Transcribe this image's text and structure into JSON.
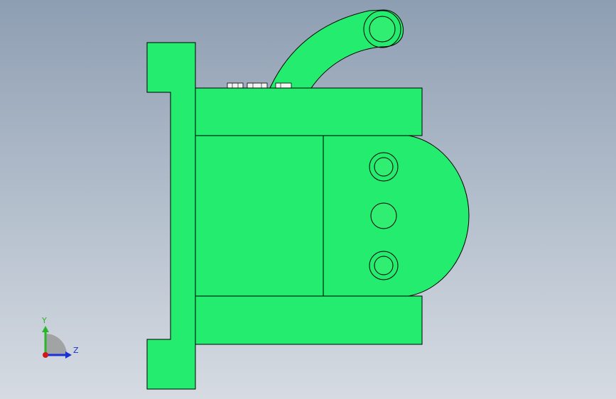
{
  "viewport": {
    "background_top": "#8e9eb2",
    "background_bottom": "#d6dbe2"
  },
  "model": {
    "part_color": "#24ec6e",
    "edge_color": "#000000",
    "hole_color": "#2fee72",
    "bolt_color": "#f2f2f2"
  },
  "triad": {
    "y_label": "Y",
    "z_label": "Z",
    "y_color": "#2ab52a",
    "z_color": "#1a2fd6",
    "x_dot_color": "#d01818",
    "arc_color": "#9a9a9a"
  }
}
